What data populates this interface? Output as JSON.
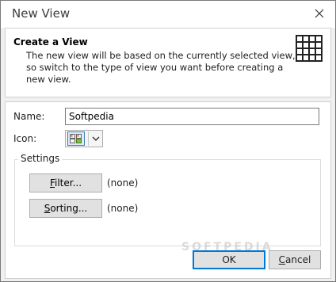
{
  "window": {
    "title": "New View"
  },
  "header": {
    "title": "Create a View",
    "description": "The new view will be based on the currently selected view, so switch to the type of view you want before creating a new view."
  },
  "form": {
    "name_label": "Name:",
    "name_value": "Softpedia",
    "icon_label": "Icon:",
    "settings_label": "Settings",
    "filter": {
      "button_label": "Filter...",
      "button_mnemonic": "F",
      "button_rest": "ilter...",
      "value": "(none)"
    },
    "sorting": {
      "button_label": "Sorting...",
      "button_mnemonic": "S",
      "button_rest": "orting...",
      "value": "(none)"
    }
  },
  "footer": {
    "ok_label": "OK",
    "cancel_label": "Cancel",
    "cancel_mnemonic": "C",
    "cancel_rest": "ancel"
  },
  "watermark": "SOFTPEDIA",
  "colors": {
    "accent": "#0078d7",
    "button_bg": "#e1e1e1",
    "dialog_bg": "#f0f0f0"
  },
  "icons": {
    "close": "close-icon",
    "grid": "grid-view-icon",
    "view_icon": "card-view-icon",
    "dropdown": "chevron-down-icon"
  }
}
